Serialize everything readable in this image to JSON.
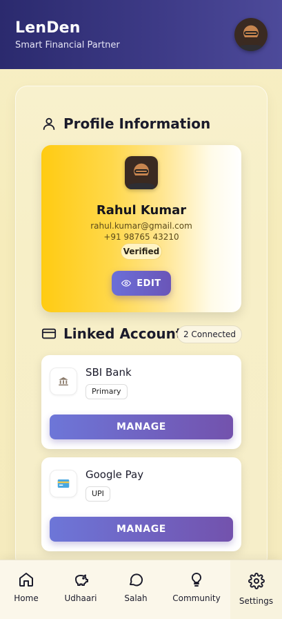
{
  "header": {
    "app_name": "LenDen",
    "tagline": "Smart Financial Partner"
  },
  "profile": {
    "section_title": "Profile Information",
    "name": "Rahul Kumar",
    "email": "rahul.kumar@gmail.com",
    "phone": "+91 98765 43210",
    "status_badge": "Verified",
    "edit_label": "EDIT"
  },
  "linked_accounts": {
    "section_title": "Linked Accounts",
    "connected_badge": "2 Connected",
    "accounts": [
      {
        "name": "SBI Bank",
        "tag": "Primary",
        "icon": "bank-icon",
        "action_label": "MANAGE"
      },
      {
        "name": "Google Pay",
        "tag": "UPI",
        "icon": "card-icon",
        "action_label": "MANAGE"
      }
    ]
  },
  "nav": {
    "items": [
      {
        "label": "Home",
        "icon": "home-icon"
      },
      {
        "label": "Udhaari",
        "icon": "piggy-bank-icon"
      },
      {
        "label": "Salah",
        "icon": "chat-bubble-icon"
      },
      {
        "label": "Community",
        "icon": "lightbulb-icon"
      },
      {
        "label": "Settings",
        "icon": "gear-icon"
      }
    ],
    "active": "Settings"
  },
  "colors": {
    "header_start": "#2b2a6e",
    "header_end": "#4d4a9a",
    "accent_gold": "#ffcb12",
    "button_start": "#6d76d8",
    "button_end": "#7352ad",
    "page_bg": "#f7efc6"
  }
}
